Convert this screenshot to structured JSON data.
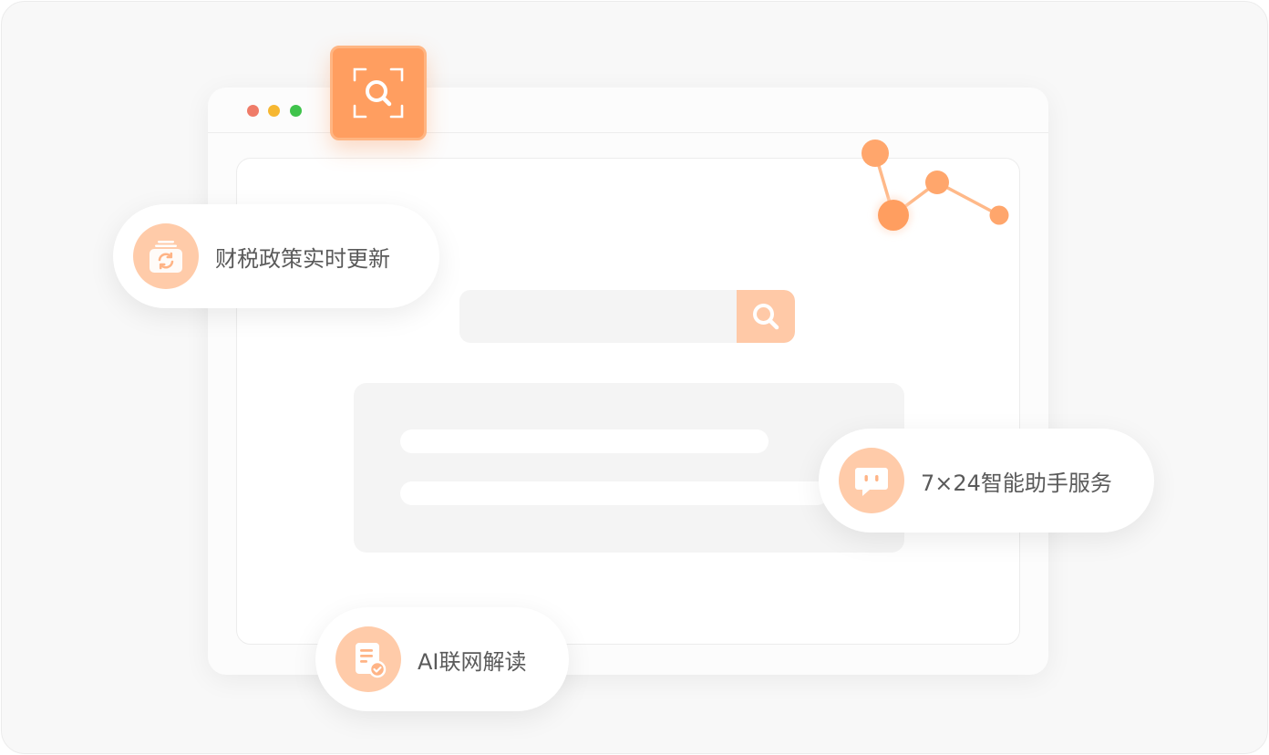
{
  "features": {
    "policy_update": {
      "label": "财税政策实时更新",
      "icon": "refresh-folder-icon"
    },
    "assistant": {
      "label": "7×24智能助手服务",
      "icon": "chat-bubble-icon"
    },
    "ai_reading": {
      "label": "AI联网解读",
      "icon": "document-check-icon"
    }
  },
  "browser": {
    "window_controls": [
      "close",
      "minimize",
      "maximize"
    ]
  },
  "colors": {
    "accent": "#ff9e60",
    "accent_light": "#ffcba9",
    "background": "#f8f8f8",
    "window_red": "#ef7b68",
    "window_yellow": "#f6b731",
    "window_green": "#3fc34b"
  }
}
